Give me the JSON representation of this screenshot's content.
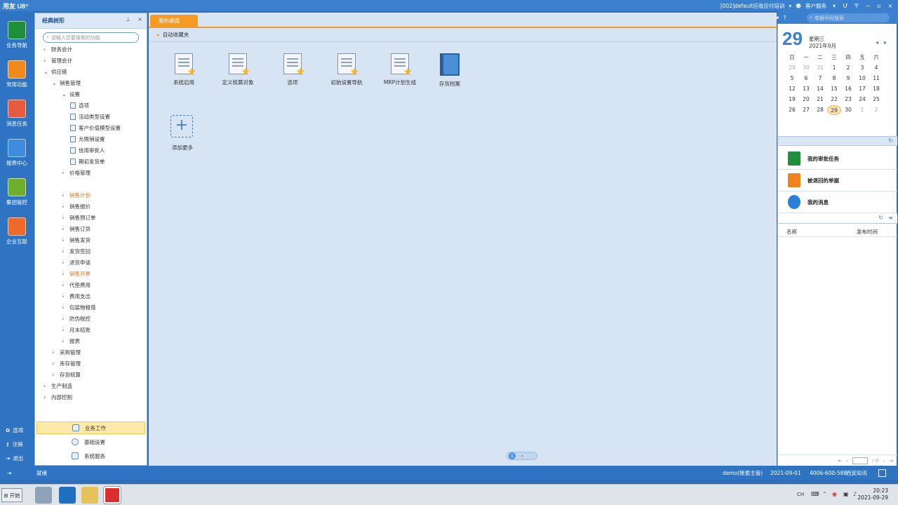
{
  "titlebar": {
    "app_name": "用友 U8⁺",
    "account": "[002]default应收应付培训",
    "customer_service": "客户服务",
    "controls": [
      "▾",
      "♥",
      "Ư",
      "〒",
      "-",
      "▫",
      "×"
    ]
  },
  "topright": {
    "search_placeholder": "单据号码搜索"
  },
  "iconbar": {
    "items": [
      {
        "label": "业务导航",
        "color": "#1f8f3c"
      },
      {
        "label": "常用功能",
        "color": "#f08a1c"
      },
      {
        "label": "消息任务",
        "color": "#e45b3d"
      },
      {
        "label": "报表中心",
        "color": "#3f8be0"
      },
      {
        "label": "集团管控",
        "color": "#6fae2a"
      },
      {
        "label": "企业互联",
        "color": "#ee6a2b"
      }
    ],
    "bottom": [
      "选项",
      "注销",
      "退出"
    ]
  },
  "nav": {
    "title": "经典树形",
    "search_placeholder": "请输入您要搜索的功能",
    "tree": [
      {
        "label": "财务会计",
        "level": 0,
        "arrow": "›",
        "kind": "branch"
      },
      {
        "label": "管理会计",
        "level": 0,
        "arrow": "›",
        "kind": "branch"
      },
      {
        "label": "供应链",
        "level": 0,
        "arrow": "⌄",
        "kind": "branch"
      },
      {
        "label": "销售管理",
        "level": 1,
        "arrow": "⌄",
        "kind": "branch"
      },
      {
        "label": "设置",
        "level": 2,
        "arrow": "⌄",
        "kind": "branch"
      },
      {
        "label": "选项",
        "level": 3,
        "arrow": "",
        "kind": "leaf"
      },
      {
        "label": "活动类型设置",
        "level": 3,
        "arrow": "",
        "kind": "leaf"
      },
      {
        "label": "客户价值模型设置",
        "level": 3,
        "arrow": "",
        "kind": "leaf"
      },
      {
        "label": "允限销设置",
        "level": 3,
        "arrow": "",
        "kind": "leaf"
      },
      {
        "label": "信用审批人",
        "level": 3,
        "arrow": "",
        "kind": "leaf"
      },
      {
        "label": "期初发货单",
        "level": 3,
        "arrow": "",
        "kind": "leaf"
      },
      {
        "label": "价格管理",
        "level": 2,
        "arrow": "›",
        "kind": "branch"
      },
      {
        "label": "",
        "level": 2,
        "arrow": "",
        "kind": "spacer"
      },
      {
        "label": "销售计划",
        "level": 2,
        "arrow": "›",
        "kind": "branch",
        "orange": true
      },
      {
        "label": "销售报价",
        "level": 2,
        "arrow": "›",
        "kind": "branch"
      },
      {
        "label": "销售预订单",
        "level": 2,
        "arrow": "›",
        "kind": "branch"
      },
      {
        "label": "销售订货",
        "level": 2,
        "arrow": "›",
        "kind": "branch"
      },
      {
        "label": "销售发货",
        "level": 2,
        "arrow": "›",
        "kind": "branch"
      },
      {
        "label": "发货签回",
        "level": 2,
        "arrow": "›",
        "kind": "branch"
      },
      {
        "label": "退货申请",
        "level": 2,
        "arrow": "›",
        "kind": "branch"
      },
      {
        "label": "销售开票",
        "level": 2,
        "arrow": "›",
        "kind": "branch",
        "orange": true
      },
      {
        "label": "代垫费用",
        "level": 2,
        "arrow": "›",
        "kind": "branch"
      },
      {
        "label": "费用支出",
        "level": 2,
        "arrow": "›",
        "kind": "branch"
      },
      {
        "label": "包装物租借",
        "level": 2,
        "arrow": "›",
        "kind": "branch"
      },
      {
        "label": "防伪税控",
        "level": 2,
        "arrow": "›",
        "kind": "branch"
      },
      {
        "label": "月末结账",
        "level": 2,
        "arrow": "›",
        "kind": "branch"
      },
      {
        "label": "报表",
        "level": 2,
        "arrow": "›",
        "kind": "branch"
      },
      {
        "label": "采购管理",
        "level": 1,
        "arrow": "›",
        "kind": "branch"
      },
      {
        "label": "库存管理",
        "level": 1,
        "arrow": "›",
        "kind": "branch"
      },
      {
        "label": "存货核算",
        "level": 1,
        "arrow": "›",
        "kind": "branch"
      },
      {
        "label": "生产制造",
        "level": 0,
        "arrow": "›",
        "kind": "branch"
      },
      {
        "label": "内部控制",
        "level": 0,
        "arrow": "›",
        "kind": "branch"
      }
    ],
    "footer": [
      {
        "label": "业务工作",
        "active": true
      },
      {
        "label": "基础设置",
        "active": false
      },
      {
        "label": "系统服务",
        "active": false
      }
    ]
  },
  "desk": {
    "tab": "我的桌面",
    "section": "自动收藏夹",
    "tiles": [
      {
        "label": "系统启用",
        "icon": "doc-star"
      },
      {
        "label": "定义核算对象",
        "icon": "doc-star"
      },
      {
        "label": "选项",
        "icon": "doc-star"
      },
      {
        "label": "初始设置导航",
        "icon": "doc-star"
      },
      {
        "label": "MRP计划生成",
        "icon": "doc-star"
      },
      {
        "label": "存货档案",
        "icon": "book"
      }
    ],
    "add_more": "添加更多",
    "page": "1"
  },
  "calendar": {
    "day": "29",
    "weekday": "星期三",
    "month": "2021年9月",
    "weekdays": [
      "日",
      "一",
      "二",
      "三",
      "四",
      "五",
      "六"
    ],
    "weeks": [
      [
        "29",
        "30",
        "31",
        "1",
        "2",
        "3",
        "4"
      ],
      [
        "5",
        "6",
        "7",
        "8",
        "9",
        "10",
        "11"
      ],
      [
        "12",
        "13",
        "14",
        "15",
        "16",
        "17",
        "18"
      ],
      [
        "19",
        "20",
        "21",
        "22",
        "23",
        "24",
        "25"
      ],
      [
        "26",
        "27",
        "28",
        "29",
        "30",
        "1",
        "2"
      ]
    ]
  },
  "tasks": [
    {
      "label": "我的审批任务",
      "color": "#1f8f3c"
    },
    {
      "label": "被退回的单据",
      "color": "#f0841c"
    },
    {
      "label": "我的消息",
      "color": "#2b7fd8"
    }
  ],
  "messages": {
    "col_name": "名称",
    "col_time": "发布时间",
    "pager_text": "/ 0"
  },
  "status": {
    "ready": "就绪",
    "user": "demo(账套主管)",
    "date": "2021-09-01",
    "phone": "4006-600-588",
    "brand": "西安知讯"
  },
  "taskbar": {
    "start": "开始",
    "lang": "CH",
    "time": "20:23",
    "date": "2021-09-29"
  }
}
